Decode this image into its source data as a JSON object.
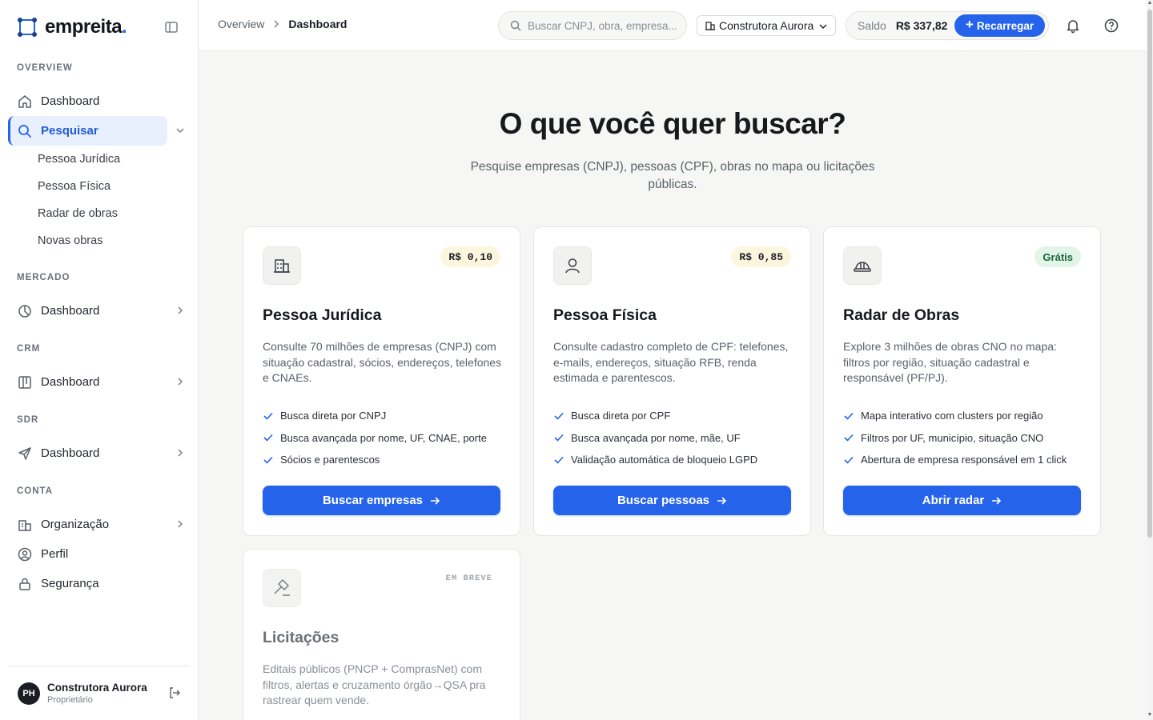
{
  "brand": {
    "name": "empreita",
    "dot": ".",
    "accent": "#2563eb"
  },
  "sidebar": {
    "sections": {
      "overview": "OVERVIEW",
      "mercado": "MERCADO",
      "crm": "CRM",
      "sdr": "SDR",
      "conta": "CONTA"
    },
    "items": {
      "dashboard": "Dashboard",
      "pesquisar": "Pesquisar",
      "sub_pj": "Pessoa Jurídica",
      "sub_pf": "Pessoa Física",
      "sub_radar": "Radar de obras",
      "sub_novas": "Novas obras",
      "mercado_dashboard": "Dashboard",
      "crm_dashboard": "Dashboard",
      "sdr_dashboard": "Dashboard",
      "organizacao": "Organização",
      "perfil": "Perfil",
      "seguranca": "Segurança"
    },
    "user": {
      "initials": "PH",
      "name": "Construtora Aurora",
      "role": "Proprietário"
    }
  },
  "topbar": {
    "breadcrumb": [
      "Overview",
      "Dashboard"
    ],
    "search_placeholder": "Buscar CNPJ, obra, empresa...",
    "org": "Construtora Aurora",
    "balance_label": "Saldo",
    "balance_value": "R$ 337,82",
    "recharge_label": "Recarregar"
  },
  "main": {
    "title": "O que você quer buscar?",
    "subtitle": "Pesquise empresas (CNPJ), pessoas (CPF), obras no mapa ou licitações públicas.",
    "cards": [
      {
        "icon": "building-icon",
        "badge": "R$ 0,10",
        "title": "Pessoa Jurídica",
        "description": "Consulte 70 milhões de empresas (CNPJ) com situação cadastral, sócios, endereços, telefones e CNAEs.",
        "features": [
          "Busca direta por CNPJ",
          "Busca avançada por nome, UF, CNAE, porte",
          "Sócios e parentescos"
        ],
        "cta": "Buscar empresas"
      },
      {
        "icon": "user-icon",
        "badge": "R$ 0,85",
        "title": "Pessoa Física",
        "description": "Consulte cadastro completo de CPF: telefones, e-mails, endereços, situação RFB, renda estimada e parentescos.",
        "features": [
          "Busca direta por CPF",
          "Busca avançada por nome, mãe, UF",
          "Validação automática de bloqueio LGPD"
        ],
        "cta": "Buscar pessoas"
      },
      {
        "icon": "hard-hat-icon",
        "badge": "Grátis",
        "title": "Radar de Obras",
        "description": "Explore 3 milhões de obras CNO no mapa: filtros por região, situação cadastral e responsável (PF/PJ).",
        "features": [
          "Mapa interativo com clusters por região",
          "Filtros por UF, município, situação CNO",
          "Abertura de empresa responsável em 1 click"
        ],
        "cta": "Abrir radar"
      },
      {
        "icon": "gavel-icon",
        "badge": "EM BREVE",
        "title": "Licitações",
        "description": "Editais públicos (PNCP + ComprasNet) com filtros, alertas e cruzamento órgão→QSA pra rastrear quem vende."
      }
    ]
  }
}
